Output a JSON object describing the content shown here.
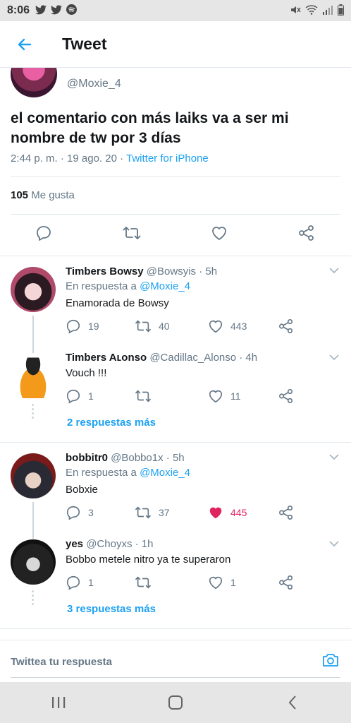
{
  "status_bar": {
    "time": "8:06"
  },
  "header": {
    "title": "Tweet"
  },
  "main_tweet": {
    "handle": "@Moxie_4",
    "text": "el comentario con más laiks va a ser mi nombre de tw por 3 días",
    "meta_prefix": "2:44 p. m. · 19 ago. 20 · ",
    "source": "Twitter for iPhone",
    "likes_count": "105",
    "likes_label": "Me gusta"
  },
  "replies": [
    {
      "name": "Timbers Bowsy",
      "handle": "@Bowsyis · 5h",
      "reply_prefix": "En respuesta a ",
      "reply_to": "@Moxie_4",
      "text": "Enamorada de Bowsy",
      "replies": "19",
      "retweets": "40",
      "likes": "443"
    },
    {
      "name": "Timbers Aʟonso",
      "handle": "@Cadillac_Alonso · 4h",
      "text": "Vouch !!!",
      "replies": "1",
      "retweets": "",
      "likes": "11"
    },
    {
      "name": "bobbitr0",
      "handle": "@Bobbo1x · 5h",
      "reply_prefix": "En respuesta a ",
      "reply_to": "@Moxie_4",
      "text": "Bobxie",
      "replies": "3",
      "retweets": "37",
      "likes": "445"
    },
    {
      "name": "yes",
      "handle": "@Choyxs · 1h",
      "text": "Bobbo metele nitro ya te superaron",
      "replies": "1",
      "retweets": "",
      "likes": "1"
    }
  ],
  "more_replies": [
    "2 respuestas más",
    "3 respuestas más"
  ],
  "composer": {
    "placeholder": "Twittea tu respuesta"
  },
  "colors": {
    "accent": "#1da1f2",
    "like": "#e0245e",
    "secondary_text": "#657786"
  }
}
